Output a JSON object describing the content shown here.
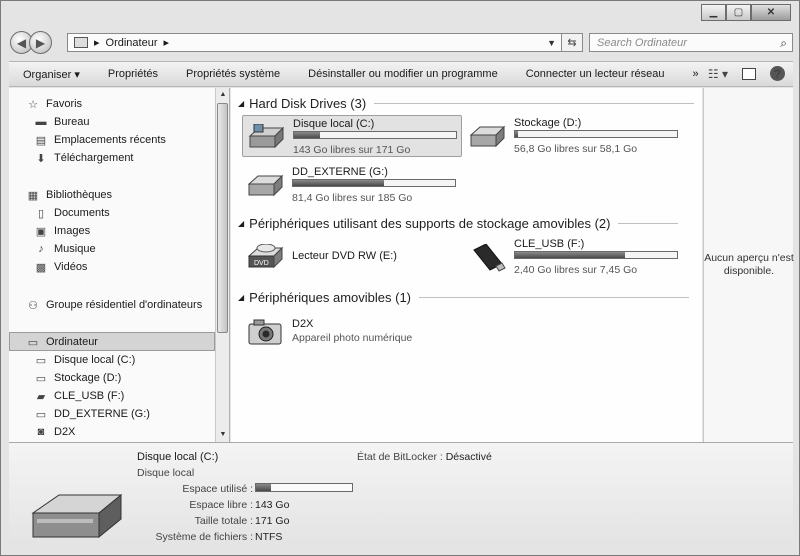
{
  "window": {
    "controls": [
      "minimize",
      "maximize",
      "close"
    ]
  },
  "address": {
    "crumbs": [
      "Ordinateur"
    ],
    "search_placeholder": "Search Ordinateur"
  },
  "toolbar": {
    "commands": [
      "Organiser",
      "Propriétés",
      "Propriétés système",
      "Désinstaller ou modifier un programme",
      "Connecter un lecteur réseau"
    ],
    "more": "»"
  },
  "sidebar": {
    "favorites": {
      "label": "Favoris",
      "items": [
        "Bureau",
        "Emplacements récents",
        "Téléchargement"
      ]
    },
    "libraries": {
      "label": "Bibliothèques",
      "items": [
        "Documents",
        "Images",
        "Musique",
        "Vidéos"
      ]
    },
    "homegroup": "Groupe résidentiel d'ordinateurs",
    "computer": {
      "label": "Ordinateur",
      "items": [
        "Disque local (C:)",
        "Stockage (D:)",
        "CLE_USB (F:)",
        "DD_EXTERNE (G:)",
        "D2X"
      ]
    }
  },
  "groups": {
    "hdd": "Hard Disk Drives (3)",
    "removable_storage": "Périphériques utilisant des supports de stockage amovibles (2)",
    "removable": "Périphériques amovibles (1)"
  },
  "drives": [
    {
      "name": "Disque local (C:)",
      "free": "143 Go libres sur 171 Go",
      "used_fraction": 0.16
    },
    {
      "name": "Stockage (D:)",
      "free": "56,8 Go libres sur 58,1 Go",
      "used_fraction": 0.02
    },
    {
      "name": "DD_EXTERNE (G:)",
      "free": "81,4 Go libres sur 185 Go",
      "used_fraction": 0.56
    },
    {
      "name": "Lecteur DVD RW (E:)"
    },
    {
      "name": "CLE_USB (F:)",
      "free": "2,40 Go libres sur 7,45 Go",
      "used_fraction": 0.68
    },
    {
      "name": "D2X",
      "kind": "Appareil photo numérique"
    }
  ],
  "preview": {
    "message": "Aucun aperçu n'est disponible."
  },
  "details": {
    "title": "Disque local (C:)",
    "kind": "Disque local",
    "used_label": "Espace utilisé :",
    "used_fraction": 0.16,
    "free_label": "Espace libre :",
    "free_value": "143 Go",
    "total_label": "Taille totale :",
    "total_value": "171 Go",
    "fs_label": "Système de fichiers :",
    "fs_value": "NTFS",
    "bitlocker_label": "État de BitLocker :",
    "bitlocker_value": "Désactivé"
  },
  "colors": {
    "bar_fill": "#4a4a4a",
    "selection": "#d4d4d4"
  }
}
